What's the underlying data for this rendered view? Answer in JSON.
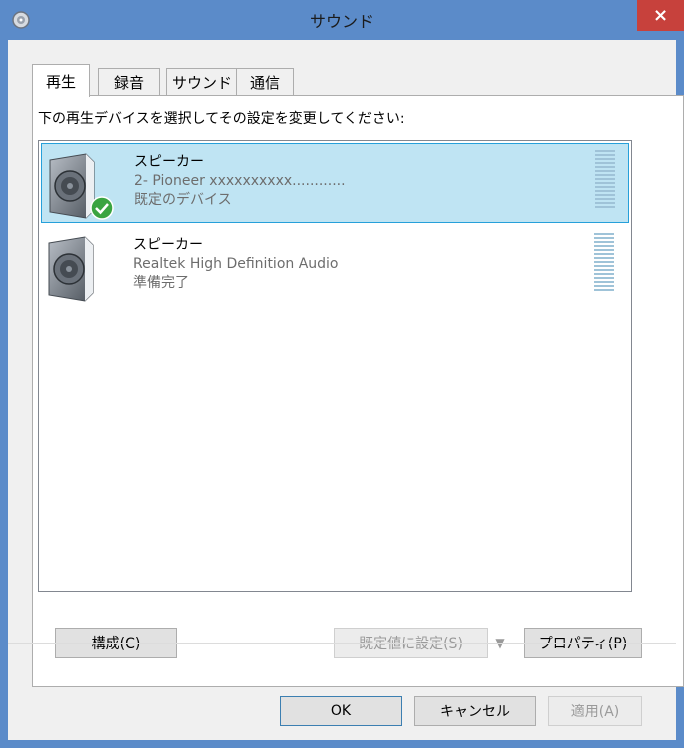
{
  "window": {
    "title": "サウンド",
    "close_label": "×"
  },
  "tabs": [
    {
      "label": "再生",
      "active": true
    },
    {
      "label": "録音",
      "active": false
    },
    {
      "label": "サウンド",
      "active": false
    },
    {
      "label": "通信",
      "active": false
    }
  ],
  "instruction": "下の再生デバイスを選択してその設定を変更してください:",
  "devices": [
    {
      "name": "スピーカー",
      "model": "2- Pioneer xxxxxxxxxx............",
      "status": "既定のデバイス",
      "selected": true,
      "default_check": true
    },
    {
      "name": "スピーカー",
      "model": "Realtek High Definition Audio",
      "status": "準備完了",
      "selected": false,
      "default_check": false
    }
  ],
  "buttons": {
    "configure": "構成(C)",
    "set_default": "既定値に設定(S)",
    "properties": "プロパティ(P)",
    "ok": "OK",
    "cancel": "キャンセル",
    "apply": "適用(A)"
  },
  "colors": {
    "titlebar": "#5b8bc9",
    "close": "#c7413c",
    "selection": "#bfe4f3",
    "selection_border": "#26a0da"
  }
}
